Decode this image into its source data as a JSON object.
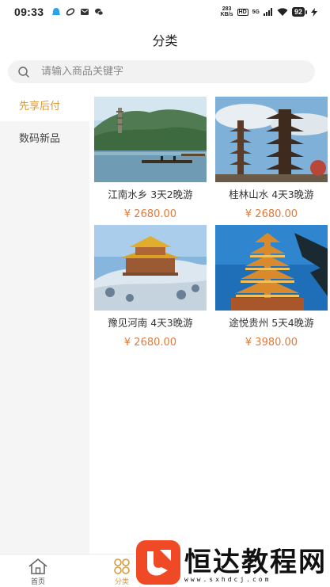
{
  "status_bar": {
    "time": "09:33",
    "net_speed_value": "283",
    "net_speed_unit": "KB/s",
    "hd_label": "HD",
    "signal_label": "5G",
    "battery": "92"
  },
  "header": {
    "title": "分类"
  },
  "search": {
    "placeholder": "请输入商品关键字",
    "value": ""
  },
  "sidebar": {
    "items": [
      {
        "label": "先享后付",
        "active": true
      },
      {
        "label": "数码新品",
        "active": false
      }
    ]
  },
  "products": [
    {
      "title": "江南水乡 3天2晚游",
      "price": "¥ 2680.00"
    },
    {
      "title": "桂林山水 4天3晚游",
      "price": "¥ 2680.00"
    },
    {
      "title": "豫见河南 4天3晚游",
      "price": "¥ 2680.00"
    },
    {
      "title": "途悦贵州 5天4晚游",
      "price": "¥ 3980.00"
    }
  ],
  "tabbar": {
    "items": [
      {
        "label": "首页",
        "icon": "home-icon",
        "active": false
      },
      {
        "label": "分类",
        "icon": "category-icon",
        "active": true
      }
    ]
  },
  "watermark": {
    "text": "恒达教程网",
    "url": "www.sxhdcj.com"
  },
  "colors": {
    "accent": "#d79a3c",
    "price": "#e07a3a",
    "sidebar_bg": "#f5f5f5",
    "search_bg": "#f2f2f2",
    "logo_red": "#ef4a25"
  }
}
